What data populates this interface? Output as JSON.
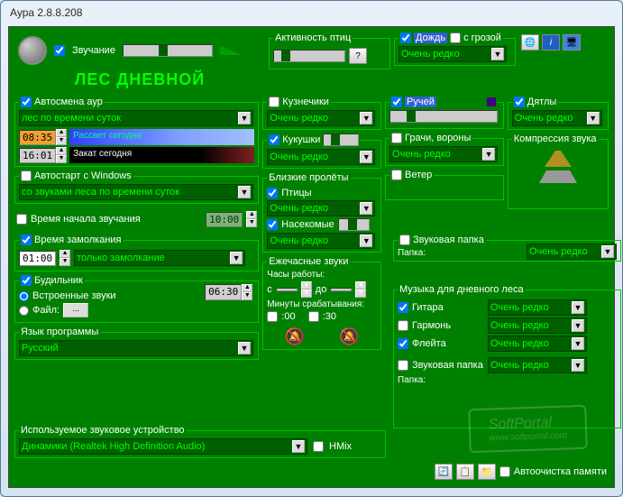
{
  "window": {
    "title": "Аура 2.8.8.208"
  },
  "sound": {
    "checkbox_label": "Звучание"
  },
  "main_title": "ЛЕС ДНЕВНОЙ",
  "left": {
    "autochange": {
      "legend": "Автосмена аур",
      "combo": "лес по времени суток",
      "sunrise_time": "08:35",
      "sunrise_label": "Рассвет сегодня",
      "sunset_time": "16:01",
      "sunset_label": "Закат сегодня"
    },
    "autostart": {
      "legend": "Автостарт с Windows",
      "combo": "со звуками леса по времени суток"
    },
    "start_time": {
      "label": "Время начала звучания",
      "value": "10:00"
    },
    "silence": {
      "legend": "Время замолкания",
      "time": "01:00",
      "combo": "только замолкание"
    },
    "alarm": {
      "legend": "Будильник",
      "time": "06:30",
      "builtin": "Встроенные звуки",
      "file": "Файл:",
      "file_btn": "..."
    },
    "lang": {
      "legend": "Язык программы",
      "combo": "Русский"
    },
    "device": {
      "legend": "Используемое звуковое устройство",
      "combo": "Динамики (Realtek High Definition Audio)",
      "hmix": "HMix"
    }
  },
  "birds": {
    "legend": "Активность птиц",
    "grasshoppers": {
      "label": "Кузнечики",
      "value": "Очень редко"
    },
    "cuckoos": {
      "label": "Кукушки",
      "value": "Очень редко"
    },
    "flyby": {
      "legend": "Близкие пролёты",
      "birds": {
        "label": "Птицы",
        "value": "Очень редко"
      },
      "insects": {
        "label": "Насекомые",
        "value": "Очень редко"
      }
    },
    "rooks": {
      "label": "Грачи, вороны",
      "value": "Очень редко"
    },
    "wind": {
      "label": "Ветер"
    },
    "woodpeckers": {
      "label": "Дятлы",
      "value": "Очень редко"
    }
  },
  "rain": {
    "label": "Дождь",
    "thunder": "с грозой",
    "value": "Очень редко"
  },
  "stream": {
    "label": "Ручей"
  },
  "compression": {
    "legend": "Компрессия звука"
  },
  "soundfolder": {
    "legend": "Звуковая папка",
    "value": "Очень редко",
    "folder_label": "Папка:"
  },
  "hourly": {
    "legend": "Ежечасные звуки",
    "hours_label": "Часы работы:",
    "from": "с",
    "to": "до",
    "minutes_label": "Минуты срабатывания:",
    "m00": ":00",
    "m30": ":30"
  },
  "music": {
    "legend": "Музыка для дневного леса",
    "guitar": {
      "label": "Гитара",
      "value": "Очень редко"
    },
    "harmony": {
      "label": "Гармонь",
      "value": "Очень редко"
    },
    "flute": {
      "label": "Флейта",
      "value": "Очень редко"
    },
    "soundfolder": {
      "label": "Звуковая папка",
      "value": "Очень редко",
      "folder_label": "Папка:"
    }
  },
  "bottom": {
    "autoclean": "Автоочистка памяти"
  }
}
